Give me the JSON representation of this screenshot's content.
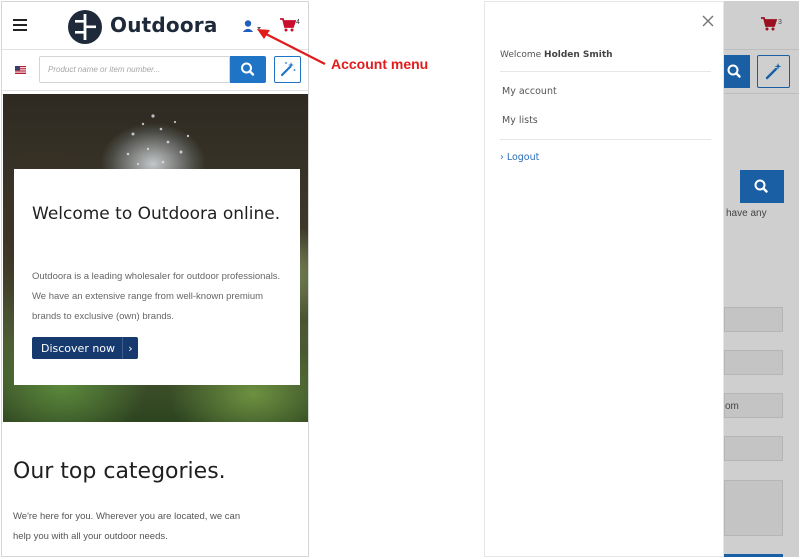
{
  "left": {
    "header": {
      "brand": "Outdoora",
      "cart_count": "4"
    },
    "search": {
      "placeholder": "Product name or item number..."
    },
    "hero": {
      "title": "Welcome to Outdoora online.",
      "text": "Outdoora is a leading wholesaler for outdoor professionals. We have an extensive range from well-known premium brands to exclusive (own) brands.",
      "button": "Discover now",
      "button_chevron": "›"
    },
    "categories": {
      "title": "Our top categories.",
      "text": "We're here for you. Wherever you are located, we can help you with all your outdoor needs."
    }
  },
  "annotation": {
    "label": "Account menu",
    "color": "#e21b1b"
  },
  "right": {
    "background": {
      "cart_count": "3",
      "text_fragment": "have any",
      "field_fragment": "om"
    },
    "drawer": {
      "welcome_prefix": "Welcome ",
      "user_name": "Holden Smith",
      "menu_items": [
        "My account",
        "My lists"
      ],
      "logout_label": "› Logout"
    }
  },
  "colors": {
    "primary_blue": "#1f74c5",
    "navy": "#163a6e",
    "cart_red": "#c8102e",
    "link_blue": "#2a6fb8"
  },
  "icons": [
    "hamburger-icon",
    "logo-icon",
    "account-icon",
    "chevron-down-icon",
    "cart-icon",
    "flag-icon",
    "search-icon",
    "magic-wand-icon",
    "close-icon"
  ]
}
